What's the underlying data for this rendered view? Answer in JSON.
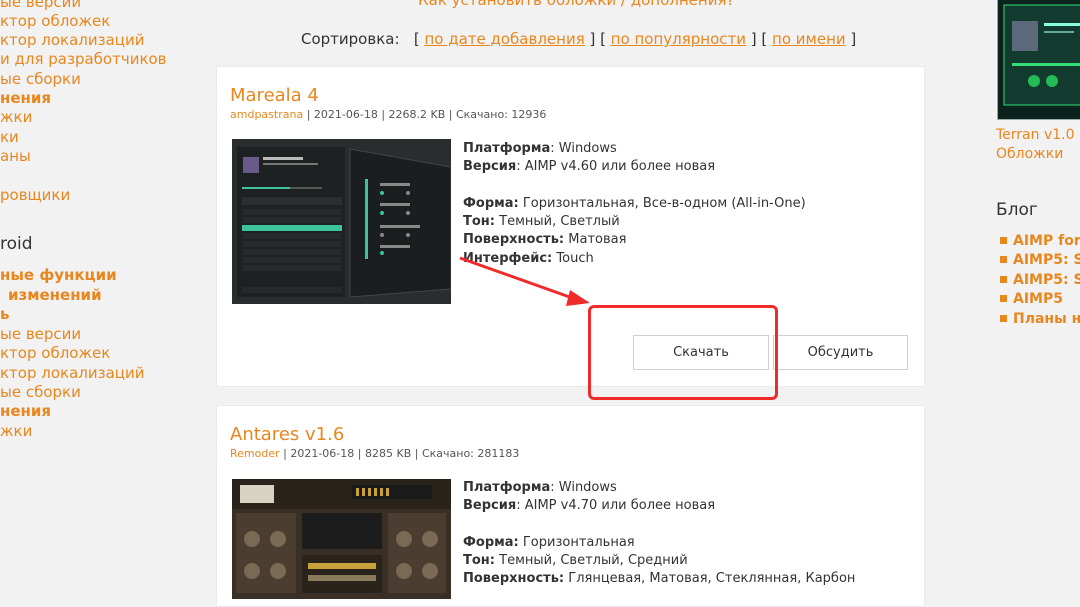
{
  "left_nav": {
    "items_a": [
      "ые версии",
      "ктор обложек",
      "ктор локализаций",
      "и для разработчиков",
      "ые сборки"
    ],
    "item_a_bold": "нения",
    "items_b": [
      "жки",
      "ки",
      "аны"
    ],
    "item_b_extra": "ровщики",
    "heading": "roid",
    "items_c_bold": [
      "ные функции",
      "изменений",
      "ь"
    ],
    "items_d": [
      "ые версии",
      "ктор обложек",
      "ктор локализаций",
      "ые сборки"
    ],
    "item_d_bold": "нения",
    "item_d_last": "жки"
  },
  "top_link": "Как установить обложки / дополнения?",
  "sort": {
    "label": "Сортировка:",
    "by_date": "по дате добавления",
    "by_popularity": "по популярности",
    "by_name": "по имени"
  },
  "cards": [
    {
      "title": "Mareala 4",
      "author": "amdpastrana",
      "date": "2021-06-18",
      "size": "2268.2 KB",
      "downloads": "Скачано: 12936",
      "specs": [
        {
          "label": "Платформа",
          "value": "Windows"
        },
        {
          "label": "Версия",
          "value": "AIMP v4.60 или более новая"
        },
        {
          "label": "Форма:",
          "value": "Горизонтальная, Все-в-одном (All-in-One)"
        },
        {
          "label": "Тон:",
          "value": "Темный, Светлый"
        },
        {
          "label": "Поверхность:",
          "value": "Матовая"
        },
        {
          "label": "Интерфейс:",
          "value": "Touch"
        }
      ],
      "download_label": "Скачать",
      "discuss_label": "Обсудить"
    },
    {
      "title": "Antares v1.6",
      "author": "Remoder",
      "date": "2021-06-18",
      "size": "8285 KB",
      "downloads": "Скачано: 281183",
      "specs": [
        {
          "label": "Платформа",
          "value": "Windows"
        },
        {
          "label": "Версия",
          "value": "AIMP v4.70 или более новая"
        },
        {
          "label": "Форма:",
          "value": "Горизонтальная"
        },
        {
          "label": "Тон:",
          "value": "Темный, Светлый, Средний"
        },
        {
          "label": "Поверхность:",
          "value": "Глянцевая, Матовая, Стеклянная, Карбон"
        }
      ]
    }
  ],
  "right": {
    "caption1": "Terran v1.0",
    "caption2": "Обложки",
    "blog_heading": "Блог",
    "blog_items": [
      "AIMP for",
      "AIMP5: S",
      "AIMP5: S",
      "AIMP5",
      "Планы н"
    ]
  },
  "colors": {
    "accent": "#e8871e",
    "annotation": "#ef2b2b",
    "background": "#f2f2f2"
  }
}
